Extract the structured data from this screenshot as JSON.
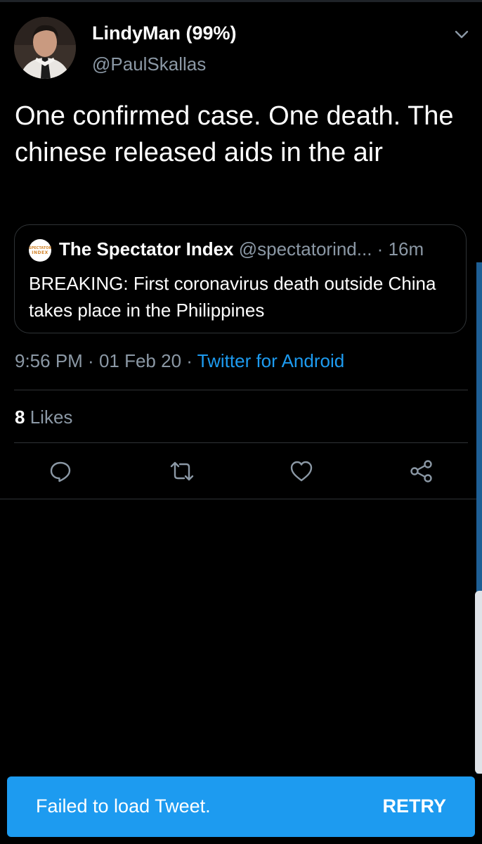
{
  "tweet": {
    "author_name": "LindyMan (99%)",
    "author_handle": "@PaulSkallas",
    "text": "One confirmed case. One death. The chinese released aids in the air",
    "quoted": {
      "avatar_line1": "SPECTATOR",
      "avatar_line2": "INDEX",
      "name": "The Spectator Index",
      "handle": "@spectatorind...",
      "separator": " · ",
      "time": "16m",
      "text": "BREAKING: First coronavirus death outside China takes place in the Philippines"
    },
    "time": "9:56 PM",
    "date": "01 Feb 20",
    "meta_separator": " · ",
    "source": "Twitter for Android",
    "likes_count": "8",
    "likes_label": "Likes"
  },
  "actions": {
    "reply_icon": "reply-icon",
    "retweet_icon": "retweet-icon",
    "like_icon": "heart-icon",
    "share_icon": "share-icon"
  },
  "toast": {
    "message": "Failed to load Tweet.",
    "action": "RETRY"
  },
  "colors": {
    "background": "#000000",
    "accent": "#1d9bf0",
    "secondary_text": "#8b98a5",
    "divider": "#2f3336"
  }
}
